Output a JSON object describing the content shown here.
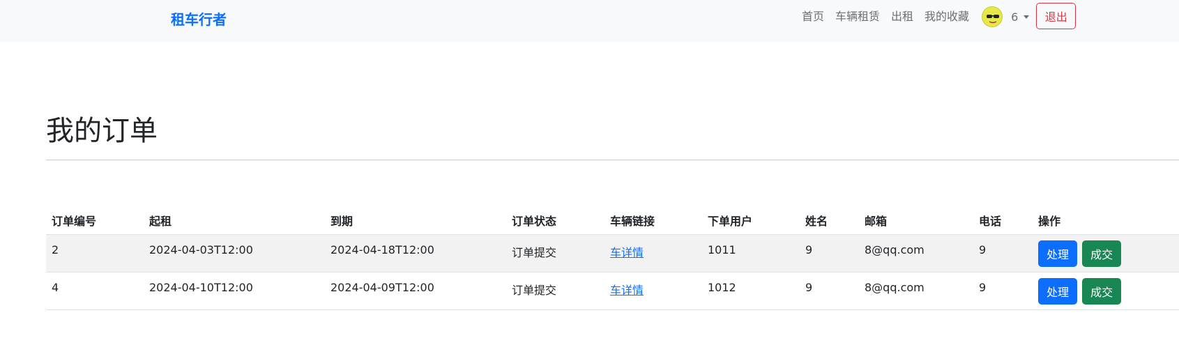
{
  "navbar": {
    "brand": "租车行者",
    "links": [
      "首页",
      "车辆租赁",
      "出租",
      "我的收藏"
    ],
    "user_name": "6",
    "logout_label": "退出"
  },
  "page": {
    "title": "我的订单"
  },
  "table": {
    "headers": [
      "订单编号",
      "起租",
      "到期",
      "订单状态",
      "车辆链接",
      "下单用户",
      "姓名",
      "邮箱",
      "电话",
      "操作"
    ],
    "rows": [
      {
        "id": "2",
        "start": "2024-04-03T12:00",
        "end": "2024-04-18T12:00",
        "status": "订单提交",
        "car_link": "车详情",
        "user": "1011",
        "name": "9",
        "email": "8@qq.com",
        "phone": "9",
        "process_label": "处理",
        "deal_label": "成交"
      },
      {
        "id": "4",
        "start": "2024-04-10T12:00",
        "end": "2024-04-09T12:00",
        "status": "订单提交",
        "car_link": "车详情",
        "user": "1012",
        "name": "9",
        "email": "8@qq.com",
        "phone": "9",
        "process_label": "处理",
        "deal_label": "成交"
      }
    ]
  },
  "colors": {
    "brand": "#0d6efd",
    "primary": "#0d6efd",
    "success": "#198754",
    "danger": "#dc3545",
    "navbar_bg": "#f8f9fa"
  },
  "icons": {
    "avatar": "sunglasses-face-avatar"
  }
}
